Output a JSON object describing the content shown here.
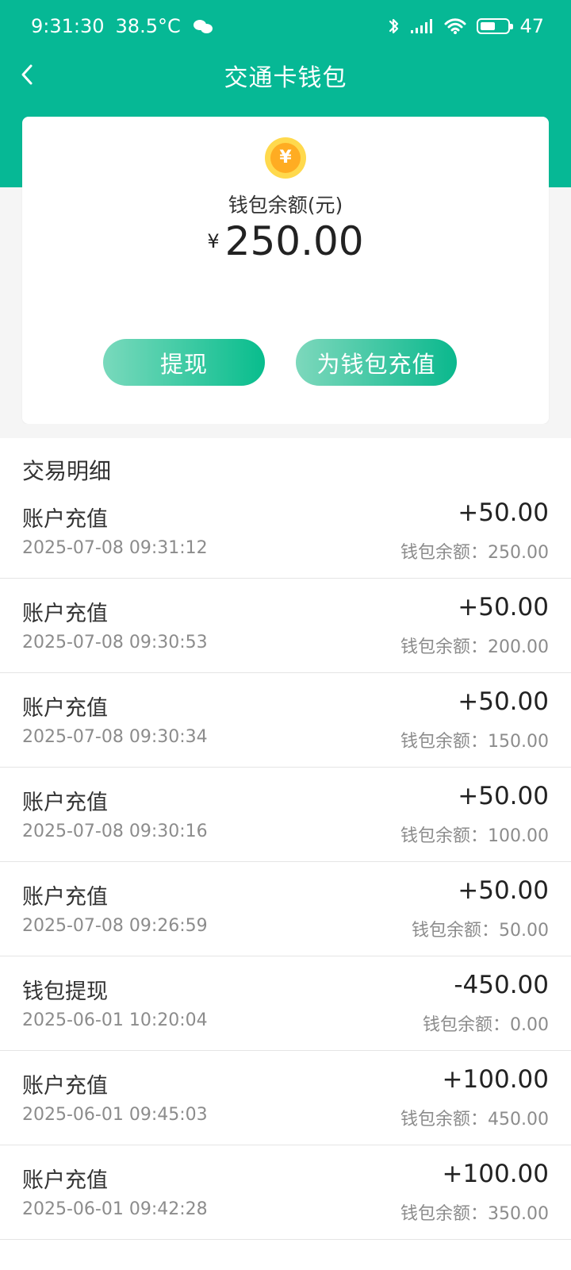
{
  "status": {
    "time": "9:31:30",
    "temperature": "38.5°C",
    "battery": "47"
  },
  "header": {
    "title": "交通卡钱包"
  },
  "wallet": {
    "label": "钱包余额(元)",
    "currency": "¥",
    "amount": "250.00",
    "withdraw_label": "提现",
    "recharge_label": "为钱包充值"
  },
  "transactions": {
    "title": "交易明细",
    "balance_prefix": "钱包余额：",
    "items": [
      {
        "type": "账户充值",
        "time": "2025-07-08 09:31:12",
        "amount": "+50.00",
        "balance": "250.00"
      },
      {
        "type": "账户充值",
        "time": "2025-07-08 09:30:53",
        "amount": "+50.00",
        "balance": "200.00"
      },
      {
        "type": "账户充值",
        "time": "2025-07-08 09:30:34",
        "amount": "+50.00",
        "balance": "150.00"
      },
      {
        "type": "账户充值",
        "time": "2025-07-08 09:30:16",
        "amount": "+50.00",
        "balance": "100.00"
      },
      {
        "type": "账户充值",
        "time": "2025-07-08 09:26:59",
        "amount": "+50.00",
        "balance": "50.00"
      },
      {
        "type": "钱包提现",
        "time": "2025-06-01 10:20:04",
        "amount": "-450.00",
        "balance": "0.00"
      },
      {
        "type": "账户充值",
        "time": "2025-06-01 09:45:03",
        "amount": "+100.00",
        "balance": "450.00"
      },
      {
        "type": "账户充值",
        "time": "2025-06-01 09:42:28",
        "amount": "+100.00",
        "balance": "350.00"
      }
    ]
  }
}
